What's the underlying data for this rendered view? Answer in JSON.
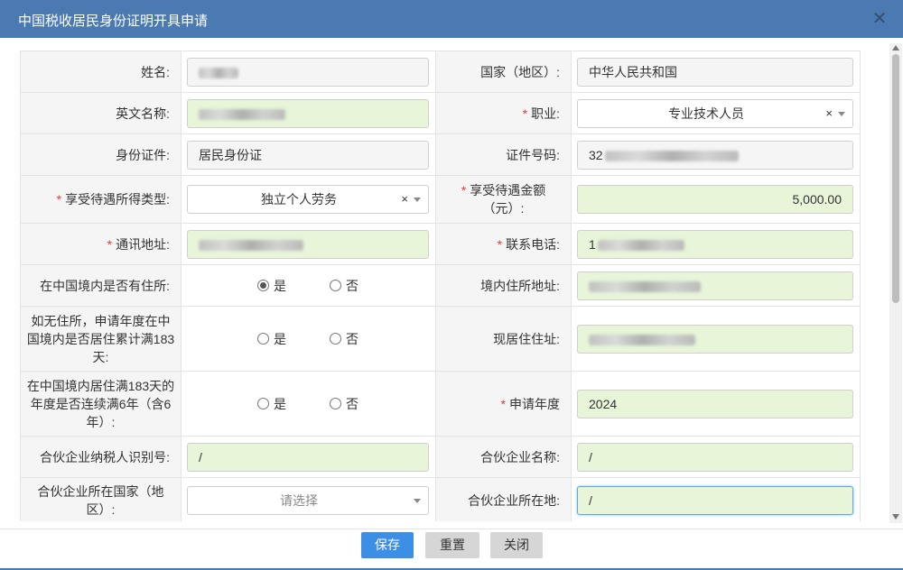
{
  "dialog": {
    "title": "中国税收居民身份证明开具申请",
    "close_icon": "close-icon"
  },
  "form": {
    "name": {
      "label": "姓名:"
    },
    "country": {
      "label": "国家（地区）:",
      "value": "中华人民共和国"
    },
    "english_name": {
      "label": "英文名称:"
    },
    "occupation": {
      "label": "职业:",
      "value": "专业技术人员",
      "clear": "×"
    },
    "id_type": {
      "label": "身份证件:",
      "value": "居民身份证"
    },
    "id_number": {
      "label": "证件号码:",
      "value_prefix": "32"
    },
    "income_type": {
      "label": "享受待遇所得类型:",
      "value": "独立个人劳务",
      "clear": "×"
    },
    "treaty_amount": {
      "label": "享受待遇金额（元）:",
      "value": "5,000.00"
    },
    "address": {
      "label": "通讯地址:"
    },
    "phone": {
      "label": "联系电话:",
      "value_prefix": "1"
    },
    "residence_in_china": {
      "label": "在中国境内是否有住所:",
      "yes": "是",
      "no": "否",
      "selected": "yes"
    },
    "domestic_address": {
      "label": "境内住所地址:"
    },
    "stay_183": {
      "label": "如无住所，申请年度在中国境内是否居住累计满183天:",
      "yes": "是",
      "no": "否",
      "selected": ""
    },
    "current_address": {
      "label": "现居住住址:"
    },
    "six_years": {
      "label": "在中国境内居住满183天的年度是否连续满6年（含6年）:",
      "yes": "是",
      "no": "否",
      "selected": ""
    },
    "apply_year": {
      "label": "申请年度",
      "value": "2024"
    },
    "partner_tax_id": {
      "label": "合伙企业纳税人识别号:",
      "value": "/"
    },
    "partner_name": {
      "label": "合伙企业名称:",
      "value": "/"
    },
    "partner_country": {
      "label": "合伙企业所在国家（地区）:",
      "placeholder": "请选择"
    },
    "partner_location": {
      "label": "合伙企业所在地:",
      "value": "/"
    },
    "required_mark": "*"
  },
  "buttons": {
    "save": "保存",
    "reset": "重置",
    "close": "关闭"
  },
  "colors": {
    "titlebar": "#4b7ab2",
    "primary": "#3d8fe5",
    "input_highlight": "#e8f5d9",
    "required": "#e53935"
  }
}
